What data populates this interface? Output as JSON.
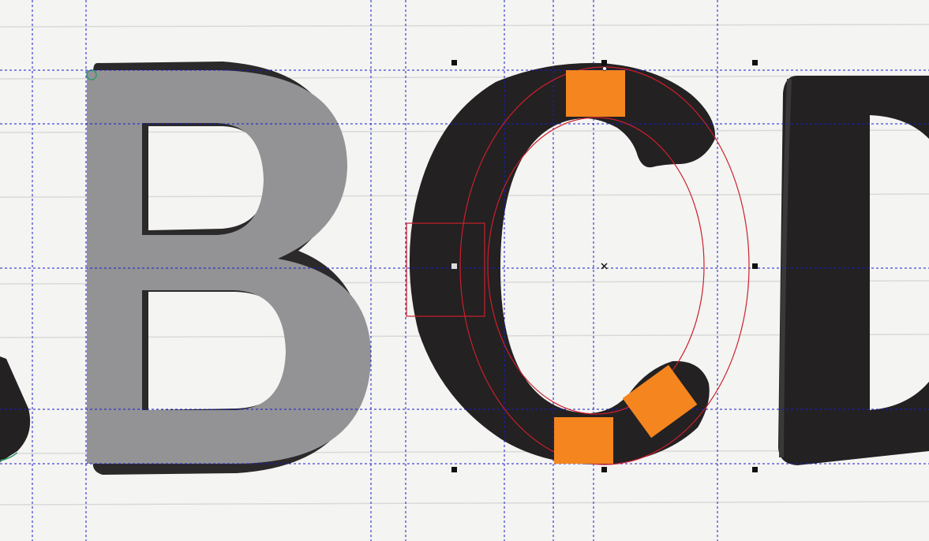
{
  "app": {
    "mode": "vector-glyph-editor"
  },
  "canvas": {
    "paper_color": "#f4f4f2",
    "ruled_line_color": "#d8d8d8",
    "ink_color": "#232122",
    "guide_color": "#1a1acc",
    "traced_glyph_fill": "#939396",
    "selection_color": "#cc1f2c",
    "handle_color": "#f4851f",
    "handle_corner_color": "#111111",
    "node_color": "#2f9a6a"
  },
  "glyphs": [
    {
      "id": "partial-left",
      "icon": "ink-stroke-fragment"
    },
    {
      "id": "B",
      "icon": "traced-letter-b"
    },
    {
      "id": "C",
      "icon": "inked-letter-c-selected"
    },
    {
      "id": "D",
      "icon": "inked-letter-d-partial"
    }
  ],
  "tools": {
    "selection": "ellipse-pair",
    "handles": "orange-width-handles",
    "center_marker": "cross-icon"
  }
}
